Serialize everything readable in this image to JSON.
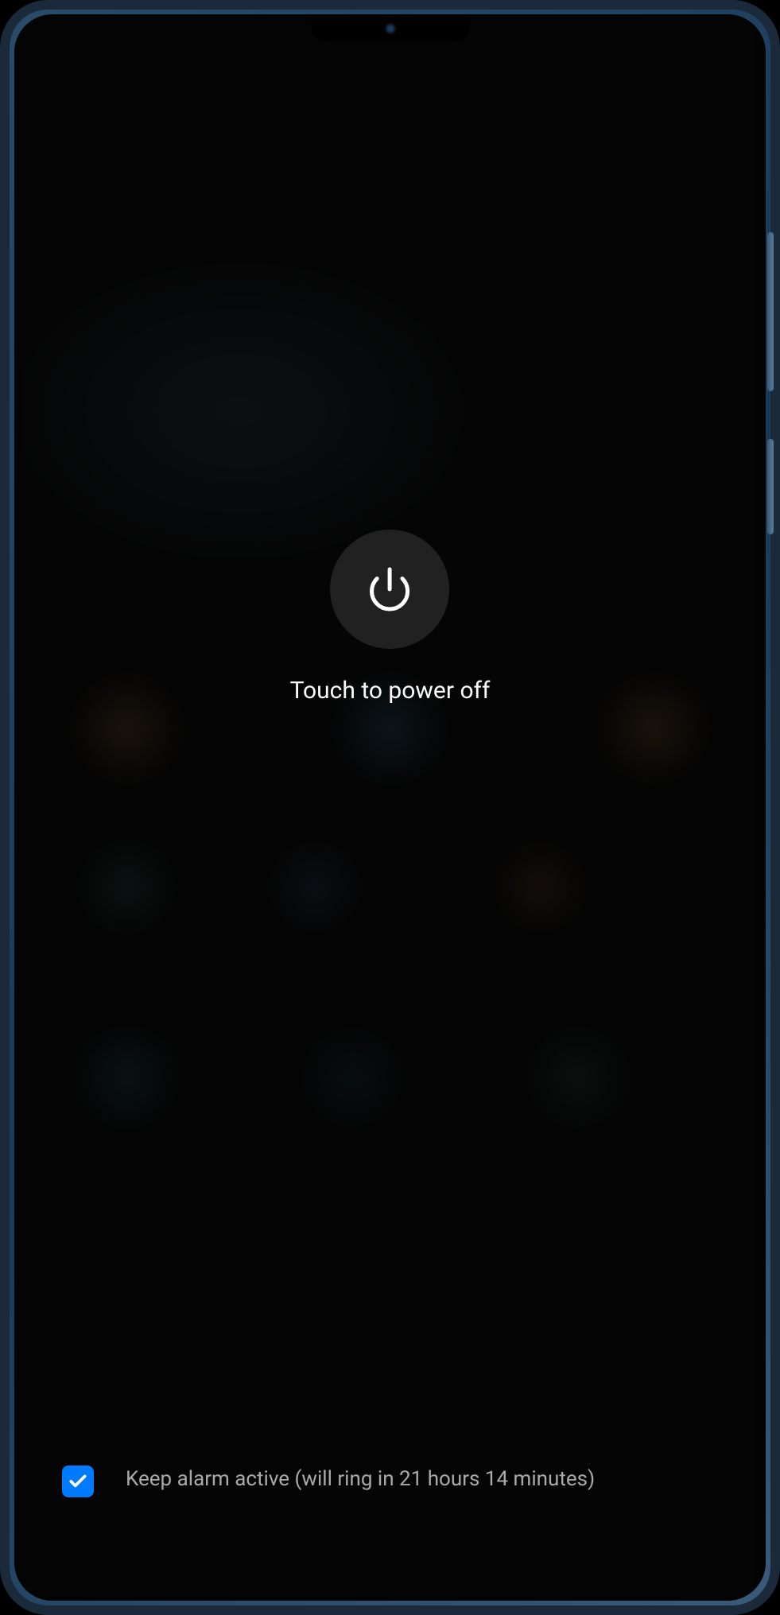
{
  "power_menu": {
    "label": "Touch to power off"
  },
  "alarm_option": {
    "checked": true,
    "text": "Keep alarm active (will ring in 21 hours 14 minutes)"
  },
  "colors": {
    "accent": "#007aff",
    "text_primary": "#ffffff",
    "text_secondary": "rgba(200, 200, 200, 0.85)"
  }
}
